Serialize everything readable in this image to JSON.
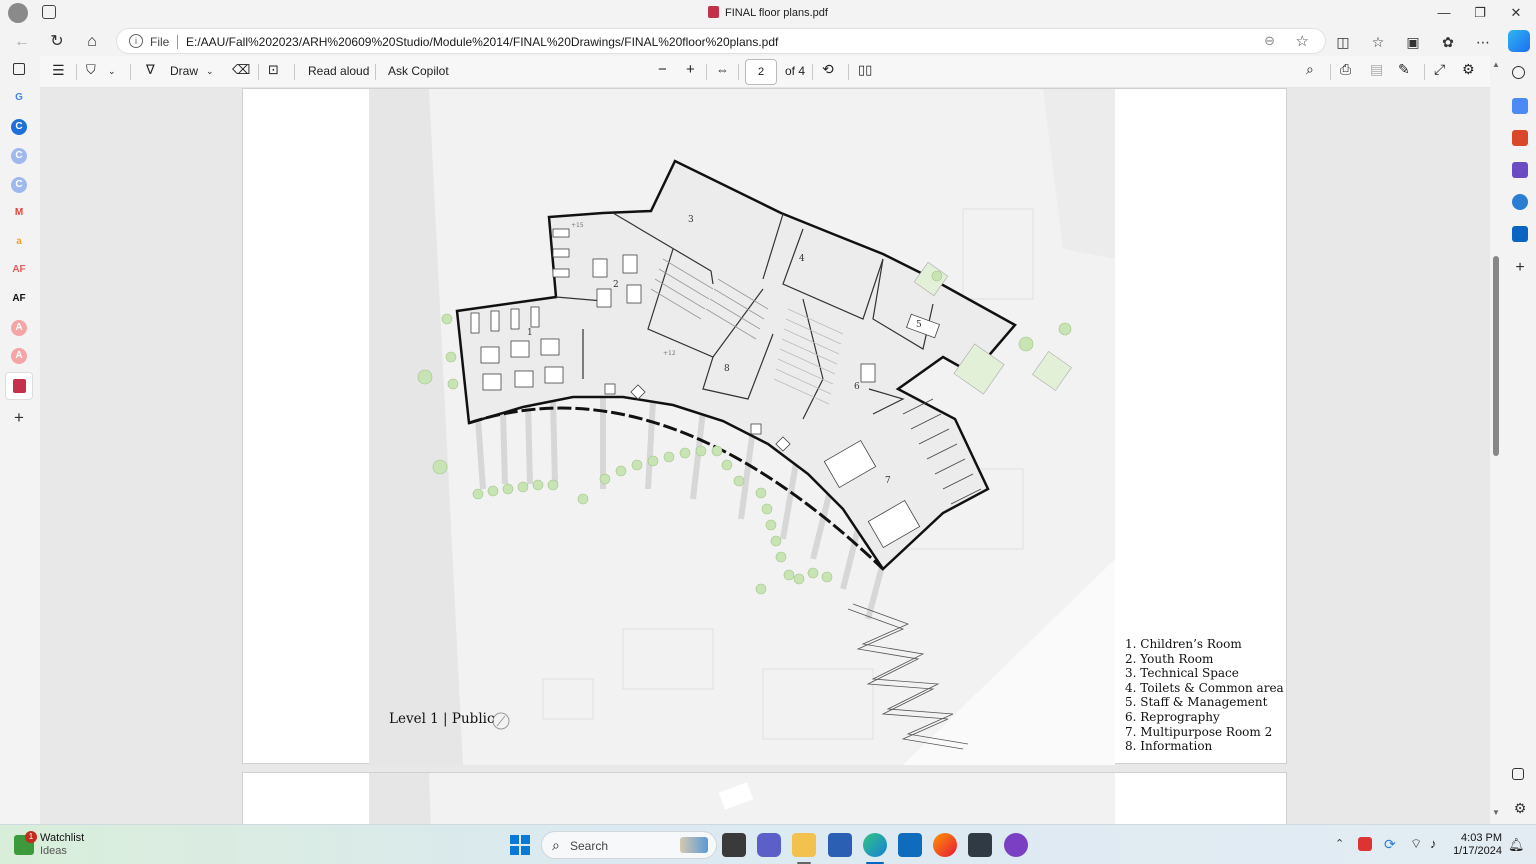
{
  "window": {
    "title": "FINAL floor plans.pdf",
    "minimize": "—",
    "maximize": "❐",
    "close": "✕"
  },
  "address": {
    "file_label": "File",
    "url": "E:/AAU/Fall%202023/ARH%20609%20Studio/Module%2014/FINAL%20Drawings/FINAL%20floor%20plans.pdf"
  },
  "pdf_toolbar": {
    "draw_label": "Draw",
    "read_aloud_label": "Read aloud",
    "ask_copilot_label": "Ask Copilot",
    "page_current": "2",
    "page_total": "of 4"
  },
  "plan": {
    "level_label": "Level 1 | Public",
    "legend": [
      "1.  Children’s Room",
      "2.  Youth Room",
      "3.  Technical Space",
      "4.  Toilets & Common area",
      "5.  Staff & Management",
      "6.  Reprography",
      "7.  Multipurpose Room 2",
      "8.  Information"
    ],
    "room_numbers": [
      "1",
      "2",
      "3",
      "4",
      "5",
      "6",
      "7",
      "8"
    ],
    "elev_labels": [
      "+15",
      "+12"
    ]
  },
  "taskbar": {
    "watchlist_title": "Watchlist",
    "watchlist_sub": "Ideas",
    "watchlist_badge": "1",
    "search_label": "Search",
    "time": "4:03 PM",
    "date": "1/17/2024"
  },
  "colors": {
    "accent": "#0067c0",
    "pdf_red": "#c4314b"
  }
}
